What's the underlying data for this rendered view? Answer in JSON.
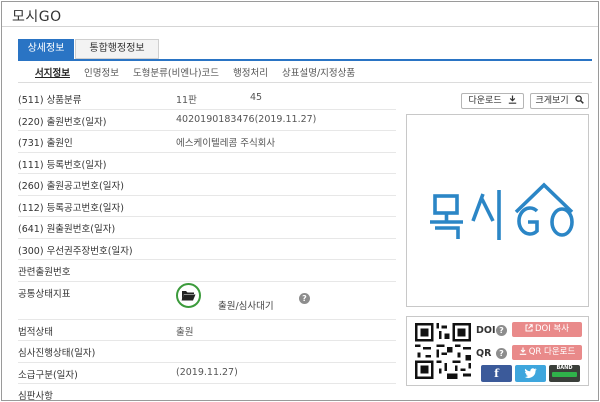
{
  "window": {
    "title": "모시GO"
  },
  "tabs": [
    {
      "label": "상세정보"
    },
    {
      "label": "통합행정정보"
    }
  ],
  "subnav": [
    {
      "label": "서지정보"
    },
    {
      "label": "인명정보"
    },
    {
      "label": "도형분류(비엔나)코드"
    },
    {
      "label": "행정처리"
    },
    {
      "label": "상표설명/지정상품"
    }
  ],
  "rows": [
    {
      "label": "(511) 상품분류",
      "value": "11판",
      "value2": "45"
    },
    {
      "label": "(220) 출원번호(일자)",
      "value": "4020190183476(2019.11.27)"
    },
    {
      "label": "(731) 출원인",
      "value": "에스케이텔레콤 주식회사"
    },
    {
      "label": "(111) 등록번호(일자)",
      "value": ""
    },
    {
      "label": "(260) 출원공고번호(일자)",
      "value": ""
    },
    {
      "label": "(112) 등록공고번호(일자)",
      "value": ""
    },
    {
      "label": "(641) 원출원번호(일자)",
      "value": ""
    },
    {
      "label": "(300) 우선권주장번호(일자)",
      "value": ""
    },
    {
      "label": "관련출원번호",
      "value": ""
    }
  ],
  "status": {
    "label": "공통상태지표",
    "text": "출원/심사대기",
    "help": "?"
  },
  "rows2": [
    {
      "label": "법적상태",
      "value": "출원"
    },
    {
      "label": "심사진행상태(일자)",
      "value": ""
    },
    {
      "label": "소급구분(일자)",
      "value": "(2019.11.27)"
    },
    {
      "label": "심판사항",
      "value": ""
    }
  ],
  "actions": {
    "download": "다운로드",
    "zoom": "크게보기"
  },
  "mark": {
    "text": "모시GO",
    "color": "#2b86c6"
  },
  "doi": {
    "doi_label": "DOI",
    "qr_label": "QR",
    "help": "?",
    "doi_copy": "DOI 복사",
    "qr_download": "QR 다운로드"
  },
  "sns": {
    "facebook": "f",
    "band": "BAND"
  },
  "colors": {
    "accent": "#2a74c4",
    "pink": "#e98a8a",
    "facebook": "#3b5a9a",
    "twitter": "#3ea6dd",
    "status_green": "#3c9b3c"
  }
}
